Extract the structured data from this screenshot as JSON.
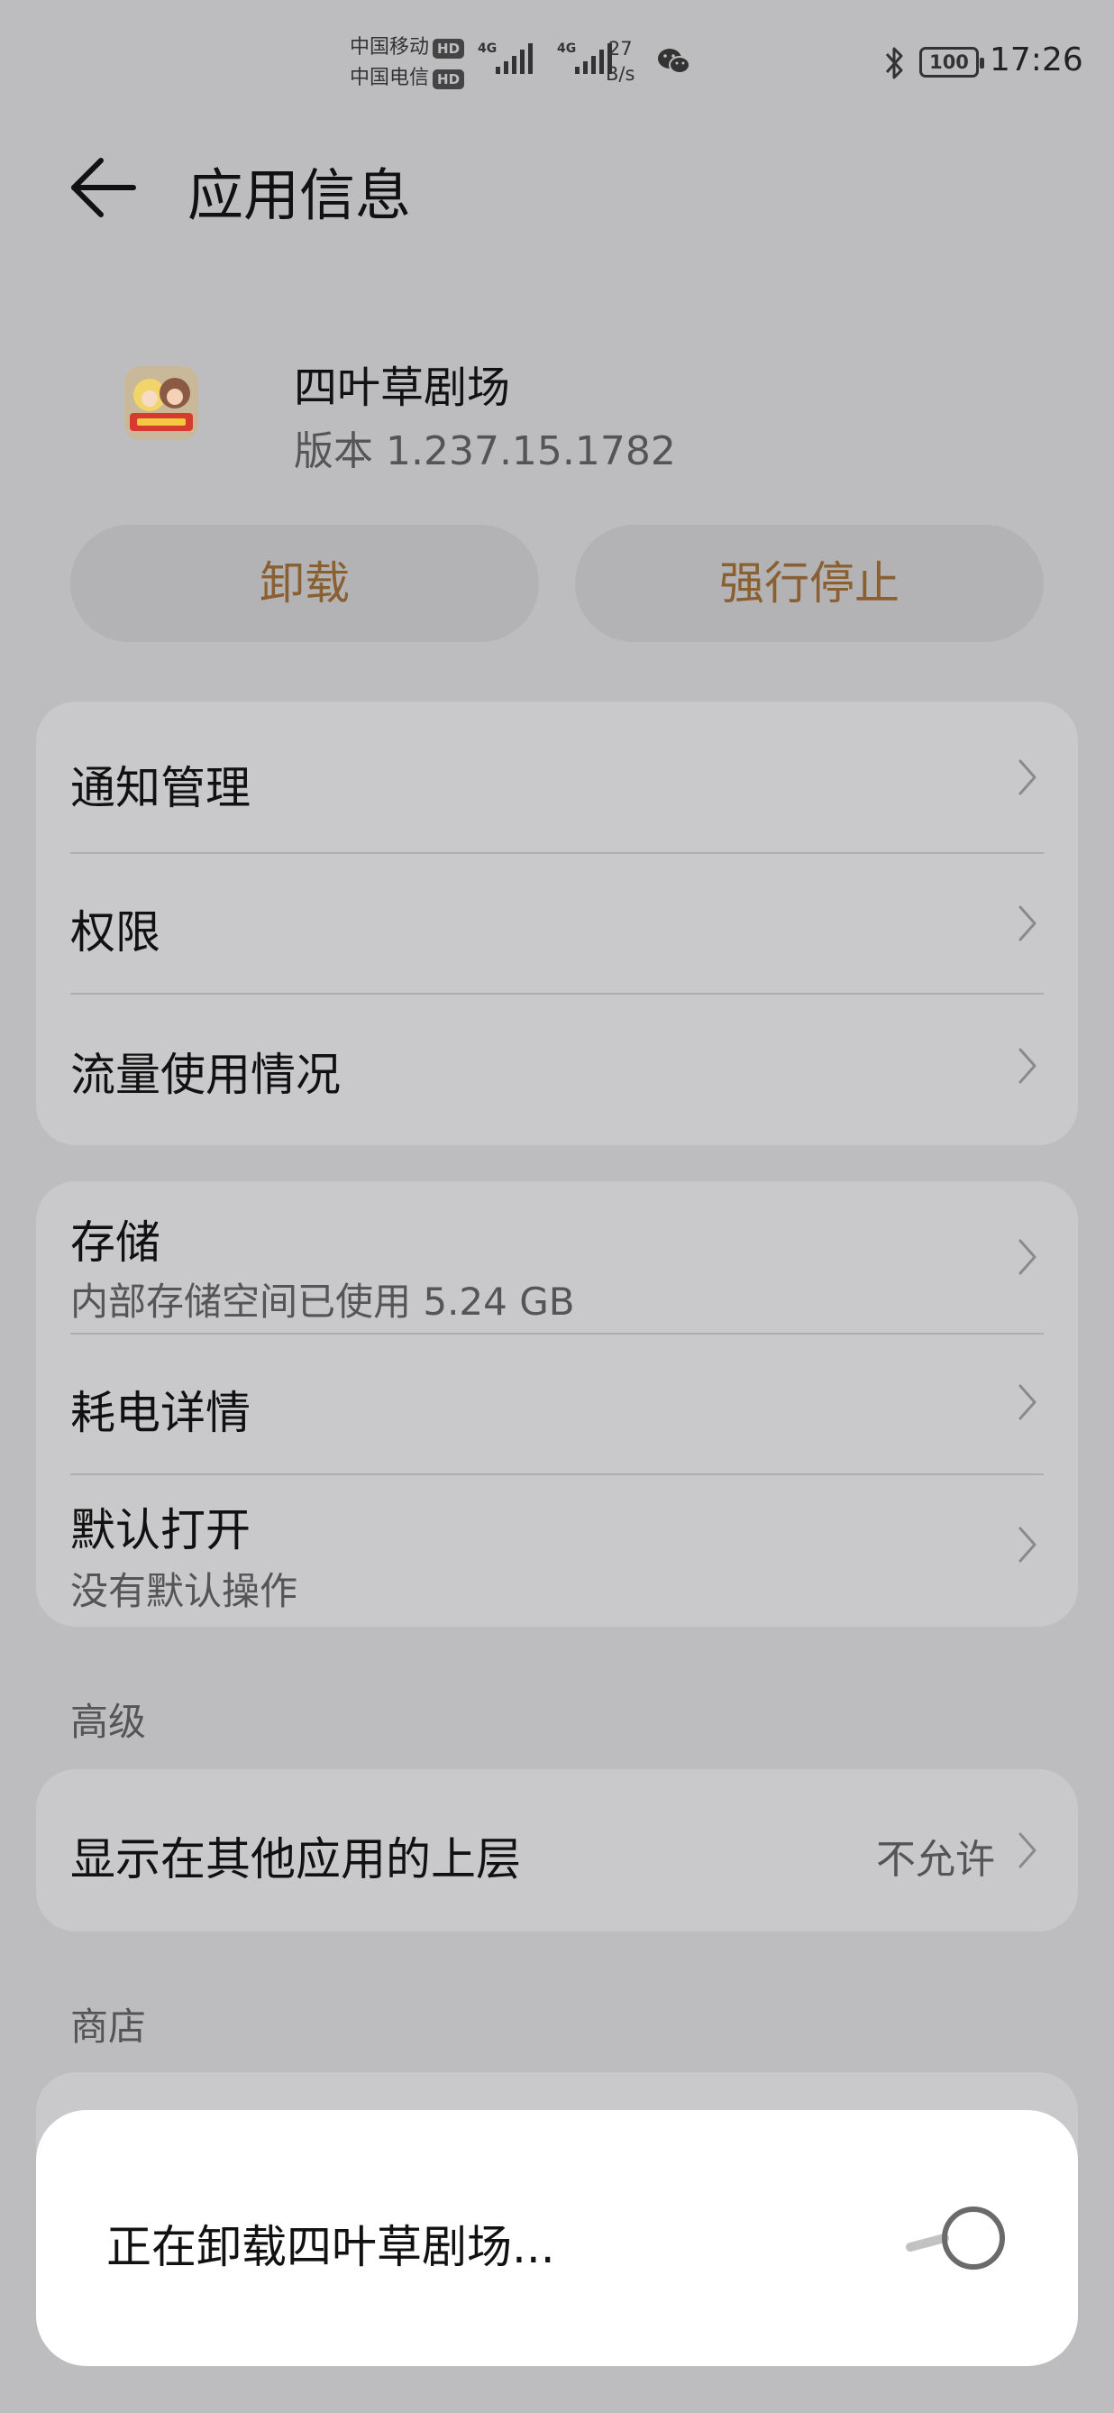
{
  "status_bar": {
    "carrier_1": "中国移动",
    "carrier_2": "中国电信",
    "hd_badge": "HD",
    "network_1": "4G",
    "network_2": "4G",
    "net_speed_value": "27",
    "net_speed_unit": "B/s",
    "battery": "100",
    "time": "17:26",
    "icons": [
      "signal-icon",
      "wechat-icon",
      "bluetooth-icon",
      "battery-icon"
    ]
  },
  "header": {
    "title": "应用信息"
  },
  "app": {
    "name": "四叶草剧场",
    "version": "版本 1.237.15.1782"
  },
  "actions": {
    "uninstall": "卸载",
    "force_stop": "强行停止"
  },
  "group1": [
    {
      "label": "通知管理"
    },
    {
      "label": "权限"
    },
    {
      "label": "流量使用情况"
    }
  ],
  "group2": [
    {
      "label": "存储",
      "sub": "内部存储空间已使用 5.24 GB"
    },
    {
      "label": "耗电详情"
    },
    {
      "label": "默认打开",
      "sub": "没有默认操作"
    }
  ],
  "advanced": {
    "section": "高级",
    "overlay_label": "显示在其他应用的上层",
    "overlay_value": "不允许"
  },
  "store": {
    "section": "商店"
  },
  "dialog": {
    "text": "正在卸载四叶草剧场..."
  },
  "colors": {
    "background": "#bdbdbf",
    "card": "#c9c9cb",
    "button_text": "#8a5f32",
    "dialog": "#ffffff"
  }
}
